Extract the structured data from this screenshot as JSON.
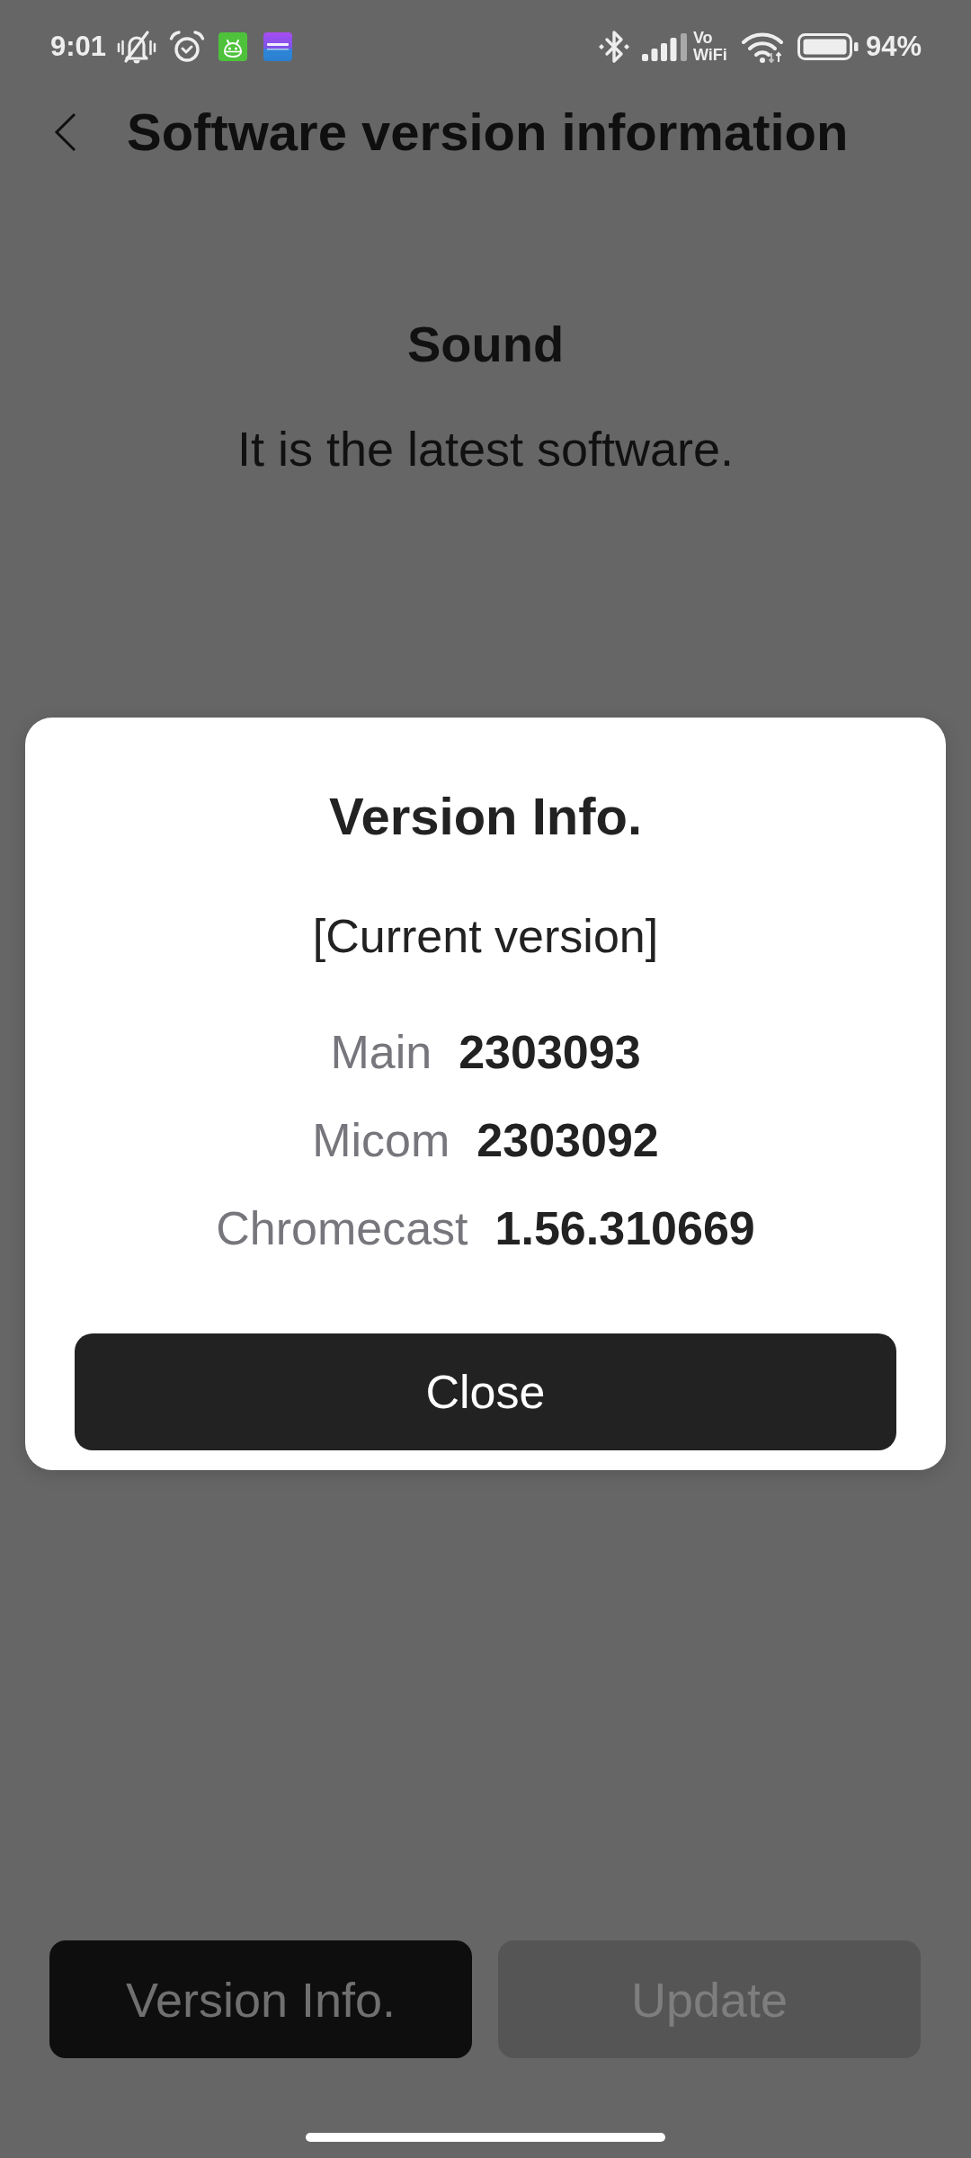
{
  "status_bar": {
    "time": "9:01",
    "vowifi": "Vo WiFi",
    "battery": "94%"
  },
  "header": {
    "title": "Software version information"
  },
  "device": {
    "name": "Sound",
    "status": "It is the latest software."
  },
  "dialog": {
    "title": "Version Info.",
    "subtitle": "[Current version]",
    "versions": [
      {
        "label": "Main",
        "value": "2303093"
      },
      {
        "label": "Micom",
        "value": "2303092"
      },
      {
        "label": "Chromecast",
        "value": "1.56.310669"
      }
    ],
    "button": "Close"
  },
  "actions": [
    {
      "label": "Version Info.",
      "disabled": false
    },
    {
      "label": "Update",
      "disabled": true
    }
  ]
}
